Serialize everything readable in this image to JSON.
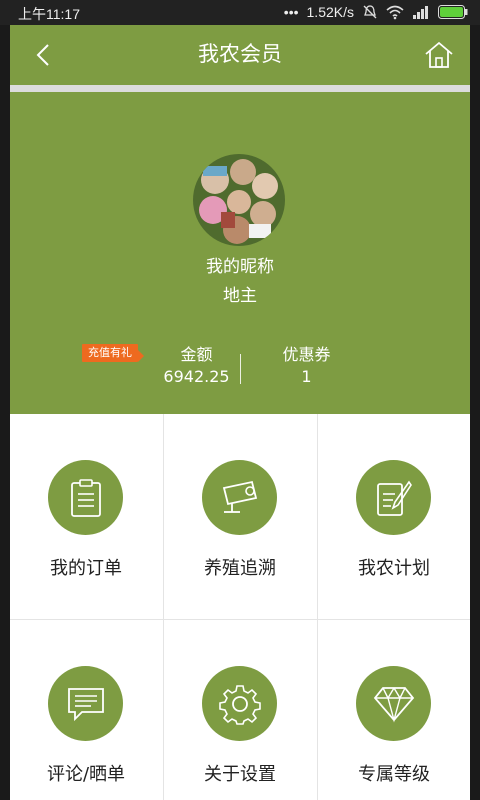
{
  "status_bar": {
    "time": "上午11:17",
    "network_speed": "1.52K/s",
    "icons": [
      "more-icon",
      "mute-icon",
      "wifi-icon",
      "signal-icon",
      "battery-icon"
    ]
  },
  "header": {
    "title": "我农会员",
    "back_icon": "back-chevron-icon",
    "home_icon": "home-icon"
  },
  "profile": {
    "nickname": "我的昵称",
    "rank": "地主",
    "promo_badge": "充值有礼",
    "amount_label": "金额",
    "amount_value": "6942.25",
    "coupon_label": "优惠券",
    "coupon_value": "1"
  },
  "menu": [
    {
      "label": "我的订单",
      "icon": "clipboard-icon"
    },
    {
      "label": "养殖追溯",
      "icon": "camera-icon"
    },
    {
      "label": "我农计划",
      "icon": "plan-edit-icon"
    },
    {
      "label": "评论/晒单",
      "icon": "comment-icon"
    },
    {
      "label": "关于设置",
      "icon": "gear-icon"
    },
    {
      "label": "专属等级",
      "icon": "diamond-icon"
    }
  ],
  "colors": {
    "brand_green": "#7e9c42",
    "promo_orange": "#ee6a1f"
  }
}
